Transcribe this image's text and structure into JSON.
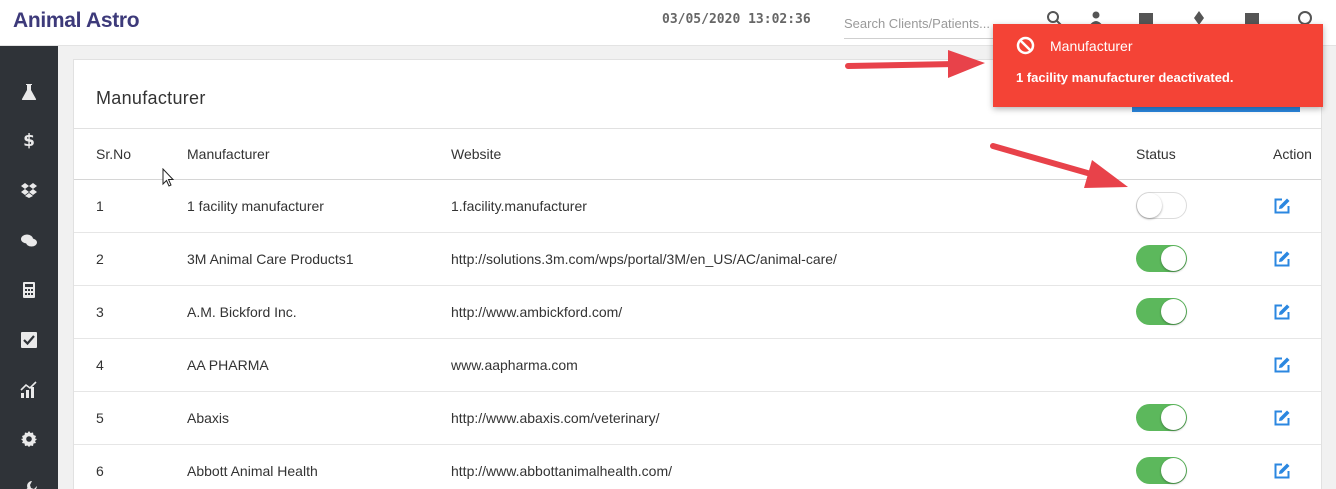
{
  "app": {
    "title": "Animal Astro",
    "datetime": "03/05/2020 13:02:36"
  },
  "search": {
    "placeholder": "Search Clients/Patients..."
  },
  "sidebar": {
    "items": [
      {
        "icon": "flask-icon"
      },
      {
        "icon": "dollar-icon",
        "glyph": "$"
      },
      {
        "icon": "dropbox-icon"
      },
      {
        "icon": "comments-icon"
      },
      {
        "icon": "calculator-icon"
      },
      {
        "icon": "checkbox-icon"
      },
      {
        "icon": "chart-icon"
      },
      {
        "icon": "gear-icon"
      },
      {
        "icon": "wrench-icon"
      }
    ]
  },
  "panel": {
    "title": "Manufacturer"
  },
  "table": {
    "columns": {
      "sr": "Sr.No",
      "name": "Manufacturer",
      "website": "Website",
      "status": "Status",
      "action": "Action"
    },
    "rows": [
      {
        "sr": "1",
        "name": "1 facility manufacturer",
        "website": "1.facility.manufacturer",
        "status": "off"
      },
      {
        "sr": "2",
        "name": "3M Animal Care Products1",
        "website": "http://solutions.3m.com/wps/portal/3M/en_US/AC/animal-care/",
        "status": "on"
      },
      {
        "sr": "3",
        "name": "A.M. Bickford Inc.",
        "website": "http://www.ambickford.com/",
        "status": "on"
      },
      {
        "sr": "4",
        "name": "AA PHARMA",
        "website": "www.aapharma.com",
        "status": "none"
      },
      {
        "sr": "5",
        "name": "Abaxis",
        "website": "http://www.abaxis.com/veterinary/",
        "status": "on"
      },
      {
        "sr": "6",
        "name": "Abbott Animal Health",
        "website": "http://www.abbottanimalhealth.com/",
        "status": "on"
      }
    ]
  },
  "toast": {
    "title": "Manufacturer",
    "message": "1 facility manufacturer deactivated.",
    "color": "#f44336"
  },
  "colors": {
    "brand": "#3d3a7a",
    "toggle_on": "#5cb85c",
    "edit_icon": "#2b87e0",
    "sidebar": "#2f3338",
    "arrow": "#e8424a"
  }
}
